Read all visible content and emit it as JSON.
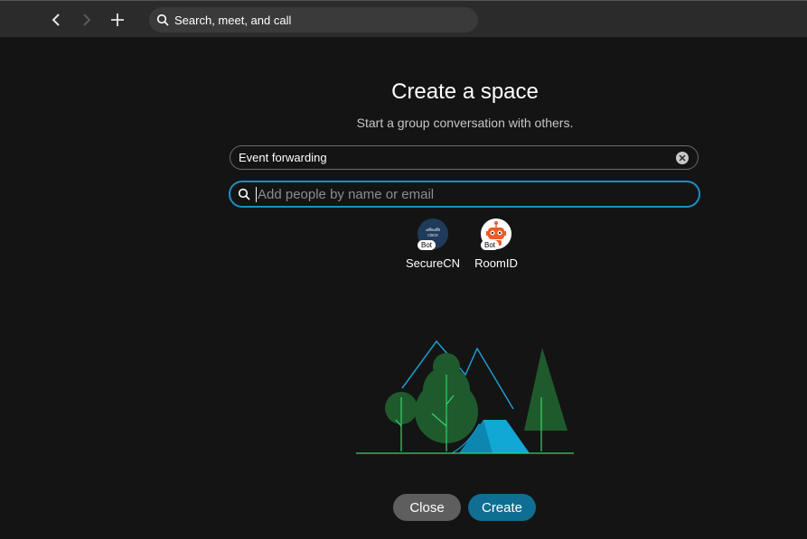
{
  "toolbar": {
    "back_icon": "chevron-left-icon",
    "forward_icon": "chevron-right-icon",
    "new_icon": "plus-icon",
    "search_placeholder": "Search, meet, and call"
  },
  "dialog": {
    "title": "Create a space",
    "subtitle": "Start a group conversation with others.",
    "space_name_value": "Event forwarding",
    "people_placeholder": "Add people by name or email",
    "suggestions": [
      {
        "name": "SecureCN",
        "badge": "Bot",
        "avatar_logo_text": "cisco",
        "avatar_color": "#1f3a5a"
      },
      {
        "name": "RoomID",
        "badge": "Bot",
        "avatar_color": "#ffffff"
      }
    ],
    "close_label": "Close",
    "create_label": "Create"
  },
  "colors": {
    "focus_border": "#1c8fc4",
    "create_button": "#0f6e92",
    "close_button": "#5e5e5e",
    "tree_green": "#1f5a2d",
    "grass_green": "#3bd16f",
    "tent_blue": "#11a8d6"
  }
}
